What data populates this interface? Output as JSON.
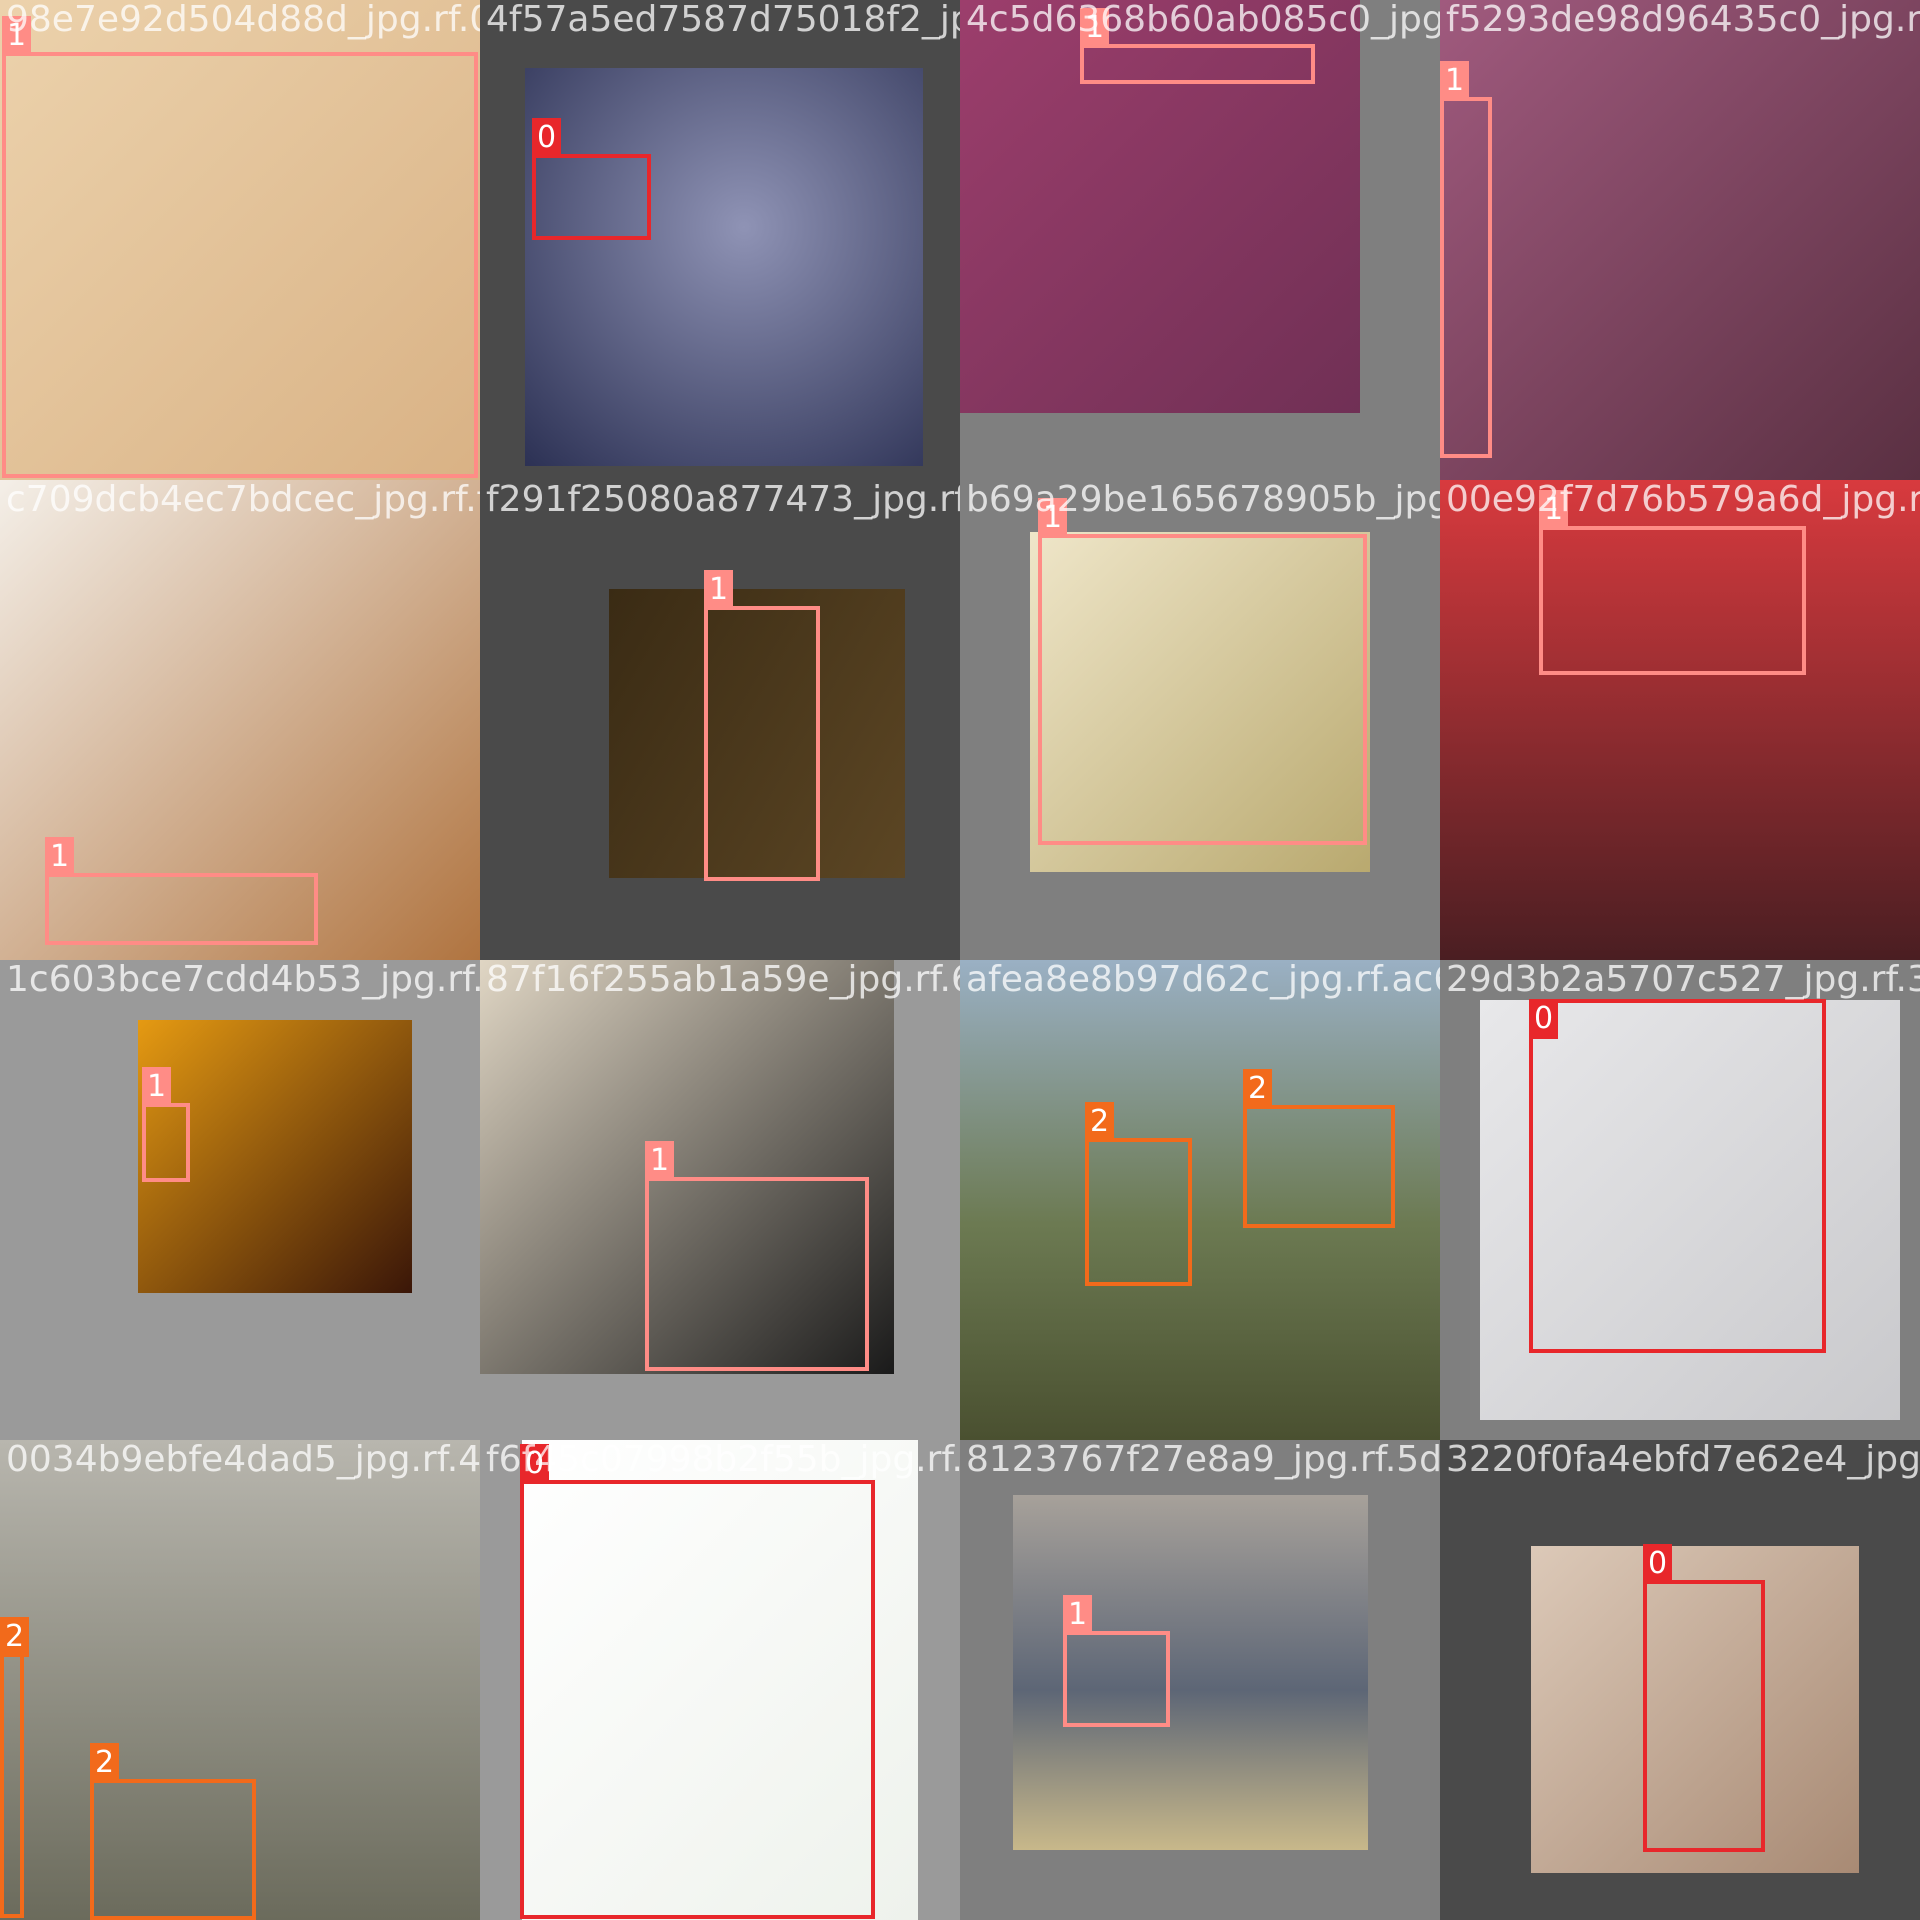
{
  "colors": {
    "class_0": "#e8272b",
    "class_1": "#ff8c86",
    "class_2": "#f26a1b"
  },
  "tiles": [
    {
      "filename": "98e7e92d504d88d_jpg.rf.04",
      "boxes": [
        {
          "label": "1"
        }
      ]
    },
    {
      "filename": "4f57a5ed7587d75018f2_jpg.rf.644",
      "boxes": [
        {
          "label": "0"
        }
      ]
    },
    {
      "filename": "4c5d6368b60ab085c0_jpg.rf.8f5",
      "boxes": [
        {
          "label": "1"
        }
      ]
    },
    {
      "filename": "f5293de98d96435c0_jpg.rf.88",
      "boxes": [
        {
          "label": "1"
        }
      ]
    },
    {
      "filename": "c709dcb4ec7bdcec_jpg.rf.fbf",
      "boxes": [
        {
          "label": "1"
        }
      ]
    },
    {
      "filename": "f291f25080a877473_jpg.rf.950",
      "boxes": [
        {
          "label": "1"
        }
      ]
    },
    {
      "filename": "b69a29be165678905b_jpg.rf.80",
      "boxes": [
        {
          "label": "1"
        }
      ]
    },
    {
      "filename": "00e92f7d76b579a6d_jpg.rf.2",
      "boxes": [
        {
          "label": "1"
        }
      ]
    },
    {
      "filename": "1c603bce7cdd4b53_jpg.rf.f44",
      "boxes": [
        {
          "label": "1"
        }
      ]
    },
    {
      "filename": "87f16f255ab1a59e_jpg.rf.64",
      "boxes": [
        {
          "label": "1"
        }
      ]
    },
    {
      "filename": "afea8e8b97d62c_jpg.rf.ac6",
      "boxes": [
        {
          "label": "2"
        },
        {
          "label": "2"
        }
      ]
    },
    {
      "filename": "29d3b2a5707c527_jpg.rf.30",
      "boxes": [
        {
          "label": "0"
        }
      ]
    },
    {
      "filename": "0034b9ebfe4dad5_jpg.rf.4a",
      "boxes": [
        {
          "label": "2"
        },
        {
          "label": "2"
        }
      ]
    },
    {
      "filename": "f6f45c07998b2f55b_jpg.rf.b64",
      "boxes": [
        {
          "label": "0"
        }
      ]
    },
    {
      "filename": "8123767f27e8a9_jpg.rf.5de",
      "boxes": [
        {
          "label": "1"
        }
      ]
    },
    {
      "filename": "3220f0fa4ebfd7e62e4_jpg.rf.48",
      "boxes": [
        {
          "label": "0"
        }
      ]
    }
  ]
}
